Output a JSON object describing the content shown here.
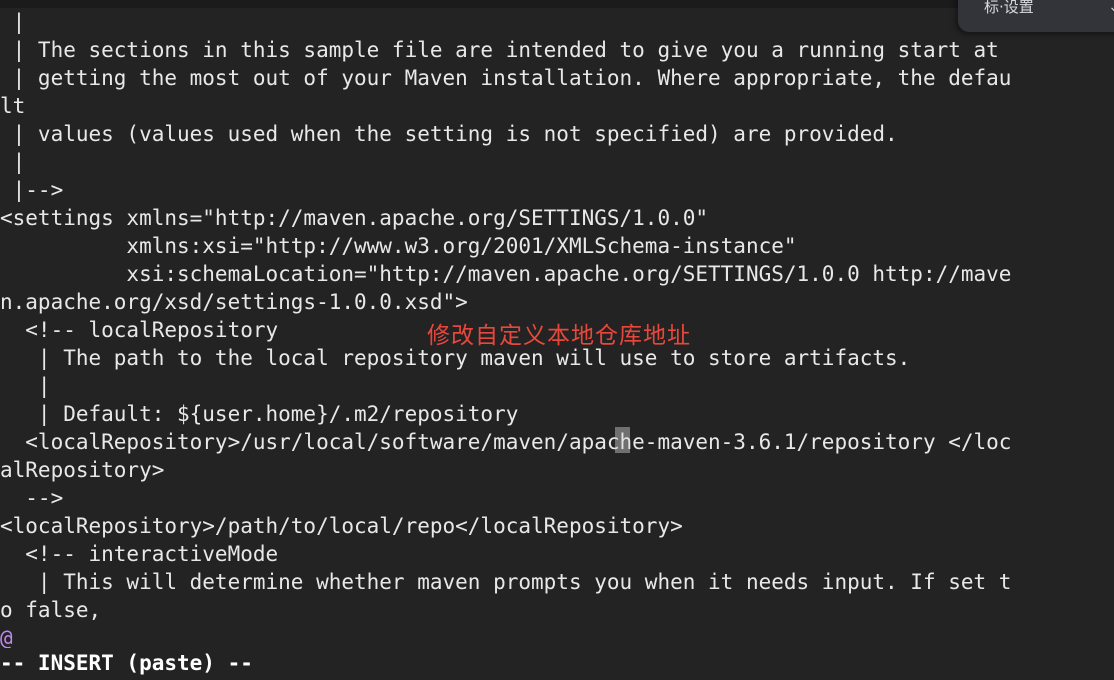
{
  "terminal": {
    "background_color": "#232323",
    "foreground_color": "#e8e8e8",
    "editor": "vim",
    "file_type": "maven-settings-xml"
  },
  "buffer": {
    "lines": [
      " |",
      " | The sections in this sample file are intended to give you a running start at",
      " | getting the most out of your Maven installation. Where appropriate, the defau",
      "lt",
      " | values (values used when the setting is not specified) are provided.",
      " |",
      " |-->",
      "<settings xmlns=\"http://maven.apache.org/SETTINGS/1.0.0\"",
      "          xmlns:xsi=\"http://www.w3.org/2001/XMLSchema-instance\"",
      "          xsi:schemaLocation=\"http://maven.apache.org/SETTINGS/1.0.0 http://mave",
      "n.apache.org/xsd/settings-1.0.0.xsd\">",
      "  <!-- localRepository",
      "   | The path to the local repository maven will use to store artifacts.",
      "   |",
      "   | Default: ${user.home}/.m2/repository",
      "  <localRepository>/usr/local/software/maven/apache-maven-3.6.1/repository </loc",
      "alRepository>",
      "  -->",
      "<localRepository>/path/to/local/repo</localRepository>",
      "  <!-- interactiveMode",
      "   | This will determine whether maven prompts you when it needs input. If set t",
      "o false,"
    ],
    "tilde_marker": "@",
    "tilde_marker_color": "#c187f0"
  },
  "statusline": {
    "text": "-- INSERT (paste) --",
    "color": "#ffffff"
  },
  "cursor": {
    "character": "/",
    "line_index": 15,
    "column": 42,
    "color": "rgba(220,220,220,0.42)"
  },
  "annotation": {
    "text": "修改自定义本地仓库地址",
    "color": "#e8483c",
    "meaning_hint": "Modify custom local repository address"
  },
  "float_panel": {
    "text": "标·设置",
    "glyph": "⌄",
    "background_color": "#33333a"
  }
}
